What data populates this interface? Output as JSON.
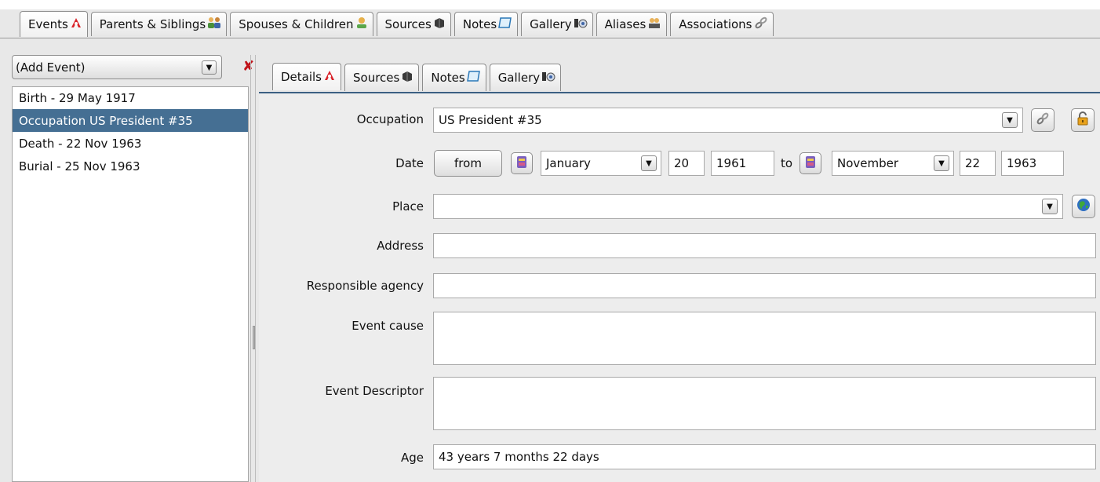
{
  "top_tabs": [
    {
      "label": "Events",
      "icon": "events-icon"
    },
    {
      "label": "Parents & Siblings",
      "icon": "family-icon"
    },
    {
      "label": "Spouses & Children",
      "icon": "person-icon"
    },
    {
      "label": "Sources",
      "icon": "source-icon"
    },
    {
      "label": "Notes",
      "icon": "note-icon"
    },
    {
      "label": "Gallery",
      "icon": "gallery-icon"
    },
    {
      "label": "Aliases",
      "icon": "alias-icon"
    },
    {
      "label": "Associations",
      "icon": "link-icon"
    }
  ],
  "events": {
    "add_event": "(Add Event)",
    "items": [
      "Birth - 29 May 1917",
      "Occupation US President #35",
      "Death - 22 Nov 1963",
      "Burial - 25 Nov 1963"
    ],
    "selected_index": 1
  },
  "detail_tabs": [
    "Details",
    "Sources",
    "Notes",
    "Gallery"
  ],
  "form": {
    "event_type_label": "Occupation",
    "event_type_value": "US President #35",
    "date_label": "Date",
    "date_mode": "from",
    "from_month": "January",
    "from_day": "20",
    "from_year": "1961",
    "to_label": "to",
    "to_month": "November",
    "to_day": "22",
    "to_year": "1963",
    "place_label": "Place",
    "place_value": "",
    "address_label": "Address",
    "address_value": "",
    "agency_label": "Responsible agency",
    "agency_value": "",
    "cause_label": "Event cause",
    "cause_value": "",
    "descriptor_label": "Event Descriptor",
    "descriptor_value": "",
    "age_label": "Age",
    "age_value": "43 years 7 months 22 days"
  },
  "colors": {
    "selection": "#456f93",
    "accent_line": "#3b5f82"
  }
}
